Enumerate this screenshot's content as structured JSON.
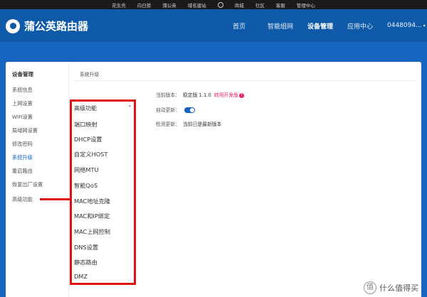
{
  "topbar": {
    "links": [
      "花生壳",
      "向日葵",
      "蒲公英",
      "域名建站",
      "商城",
      "社区",
      "客服",
      "管理中心"
    ]
  },
  "header": {
    "brand": "蒲公英路由器",
    "nav": [
      "首页",
      "智能组网",
      "设备管理",
      "应用中心"
    ],
    "active_nav": "设备管理",
    "account": "0448094..."
  },
  "sidebar": {
    "title": "设备管理",
    "items": [
      "系统信息",
      "上网设置",
      "WiFi设置",
      "局域网设置",
      "修改密码",
      "系统升级",
      "重启路由",
      "恢复出厂设置",
      "高级功能"
    ],
    "current": "系统升级"
  },
  "content": {
    "breadcrumb": "系统升级",
    "current_version_label": "当前版本：",
    "current_version_value": "稳定版  1.1.0",
    "dev_link": "转用开发版",
    "auto_update_label": "自动更新：",
    "auto_update_on": true,
    "check_label": "检测更新：",
    "check_value": "当前已是最新版本"
  },
  "dropdown": {
    "title": "高级功能",
    "items": [
      "端口映射",
      "DHCP设置",
      "自定义HOST",
      "网络MTU",
      "智能QoS",
      "MAC地址克隆",
      "MAC和IP绑定",
      "MAC上网控制",
      "DNS设置",
      "静态路由",
      "DMZ"
    ],
    "highlight_color": "#e01010"
  },
  "watermark": {
    "icon_glyph": "值",
    "text": "什么值得买"
  },
  "colors": {
    "brand_blue": "#1565c0",
    "header_blue": "#0e5aa8",
    "accent_pink": "#e91e63",
    "annotation_red": "#e01010"
  }
}
